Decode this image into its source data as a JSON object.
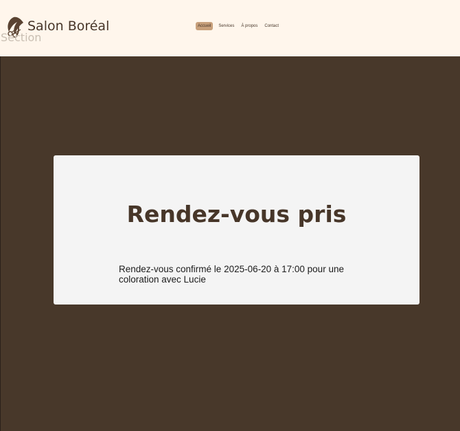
{
  "header": {
    "brand": "Salon Boréal",
    "ghost_label": "Section",
    "nav": [
      {
        "label": "Accueil",
        "active": true
      },
      {
        "label": "Services",
        "active": false
      },
      {
        "label": "À propos",
        "active": false
      },
      {
        "label": "Contact",
        "active": false
      }
    ]
  },
  "card": {
    "title": "Rendez-vous pris",
    "message": "Rendez-vous confirmé le 2025-06-20 à 17:00 pour une coloration avec Lucie"
  },
  "colors": {
    "header_bg": "#fff6ec",
    "main_bg": "#48382a",
    "card_bg": "#f4f4f4",
    "brand_text": "#473629",
    "nav_active_bg": "#c8a07b"
  },
  "icons": {
    "logo": "hair-salon-logo-icon"
  }
}
